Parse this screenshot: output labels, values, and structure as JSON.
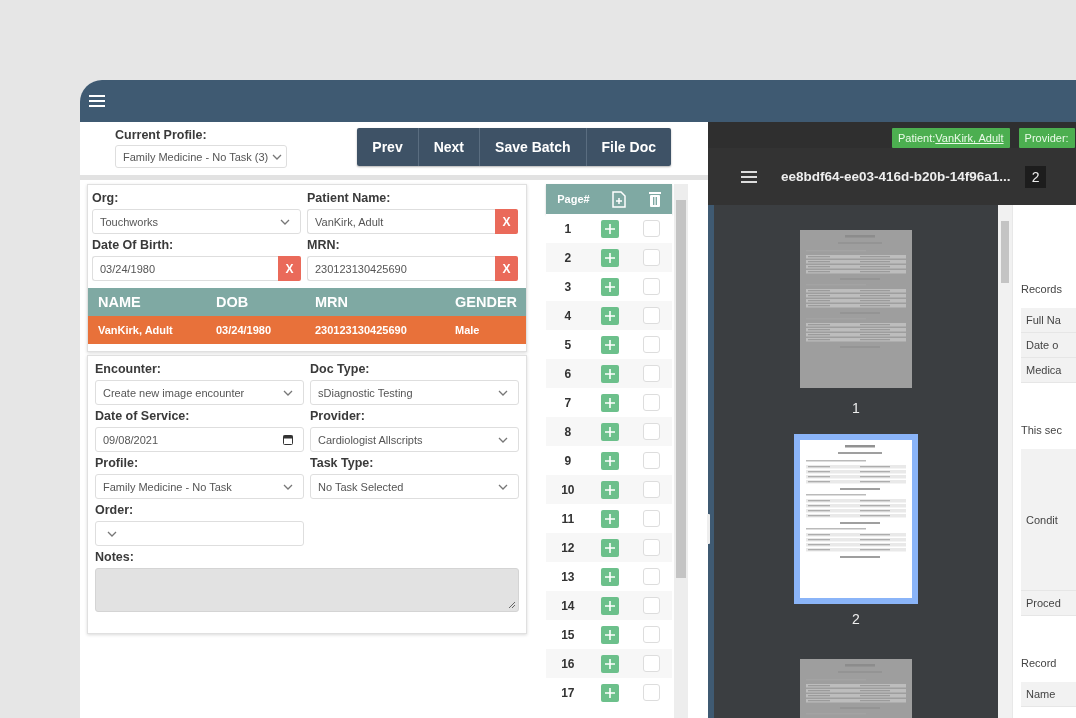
{
  "profile": {
    "label": "Current Profile:",
    "value": "Family Medicine - No Task (3)"
  },
  "actions": [
    "Prev",
    "Next",
    "Save Batch",
    "File Doc"
  ],
  "patient_search": {
    "fields": [
      {
        "label": "Org:",
        "value": "Touchworks",
        "kind": "select"
      },
      {
        "label": "Patient Name:",
        "value": "VanKirk, Adult",
        "kind": "clearable",
        "clear": "X"
      },
      {
        "label": "Date Of Birth:",
        "value": "03/24/1980",
        "kind": "clearable",
        "clear": "X"
      },
      {
        "label": "MRN:",
        "value": "230123130425690",
        "kind": "clearable",
        "clear": "X"
      }
    ]
  },
  "results": {
    "columns": [
      "NAME",
      "DOB",
      "MRN",
      "GENDER"
    ],
    "rows": [
      {
        "cells": [
          "VanKirk, Adult",
          "03/24/1980",
          "230123130425690",
          "Male"
        ],
        "selected": true
      }
    ]
  },
  "encounter": {
    "fields": [
      {
        "label": "Encounter:",
        "value": "Create new image encounter",
        "kind": "select"
      },
      {
        "label": "Doc Type:",
        "value": "sDiagnostic Testing",
        "kind": "select"
      },
      {
        "label": "Date of Service:",
        "value": "09/08/2021",
        "kind": "date"
      },
      {
        "label": "Provider:",
        "value": "Cardiologist Allscripts",
        "kind": "select"
      },
      {
        "label": "Profile:",
        "value": "Family Medicine - No Task",
        "kind": "select"
      },
      {
        "label": "Task Type:",
        "value": "No Task Selected",
        "kind": "select"
      },
      {
        "label": "Order:",
        "kind": "select"
      },
      {
        "label": "Notes:",
        "kind": "textarea"
      }
    ]
  },
  "pages": {
    "header": "Page#",
    "rows": [
      {
        "number": "1",
        "checked": false
      },
      {
        "number": "2",
        "checked": false
      },
      {
        "number": "3",
        "checked": false
      },
      {
        "number": "4",
        "checked": false
      },
      {
        "number": "5",
        "checked": false
      },
      {
        "number": "6",
        "checked": false
      },
      {
        "number": "7",
        "checked": false
      },
      {
        "number": "8",
        "checked": false
      },
      {
        "number": "9",
        "checked": false
      },
      {
        "number": "10",
        "checked": false
      },
      {
        "number": "11",
        "checked": false
      },
      {
        "number": "12",
        "checked": false
      },
      {
        "number": "13",
        "checked": false
      },
      {
        "number": "14",
        "checked": false
      },
      {
        "number": "15",
        "checked": false
      },
      {
        "number": "16",
        "checked": false
      },
      {
        "number": "17",
        "checked": false
      }
    ]
  },
  "viewer": {
    "tags": [
      {
        "label": "Patient:",
        "link": "VanKirk, Adult"
      },
      {
        "label": "Provider:"
      }
    ],
    "title": "ee8bdf64-ee03-416d-b20b-14f96a1...",
    "page_number": "2",
    "thumbnails": [
      {
        "label": "1",
        "selected": false
      },
      {
        "label": "2",
        "selected": true
      },
      {
        "selected": false
      }
    ],
    "document": [
      {
        "heading": "Records",
        "rows": [
          {
            "label": "Full Na",
            "kind": "normal"
          },
          {
            "label": "Date o",
            "kind": "normal"
          },
          {
            "label": "Medica",
            "kind": "normal"
          }
        ]
      },
      {
        "heading": "This sec",
        "rows": [
          {
            "label": "Condit",
            "kind": "tall"
          },
          {
            "label": "Proced",
            "kind": "normal"
          }
        ]
      },
      {
        "heading": "Record",
        "rows": [
          {
            "label": "Name",
            "kind": "normal"
          }
        ]
      }
    ]
  }
}
